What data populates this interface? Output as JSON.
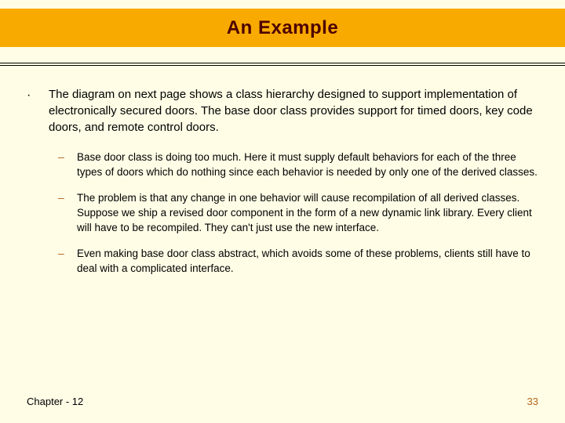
{
  "title": "An Example",
  "main_bullet": "The diagram on next page shows a class hierarchy designed to support implementation of electronically secured doors.  The base door class provides support for timed doors, key code doors, and remote control doors.",
  "sub_bullets": [
    "Base door class is doing too much.  Here it must supply default behaviors for each of the three types of doors which do nothing since each behavior is needed by only one of the derived classes.",
    "The problem is that any change in one behavior will cause recompilation of all derived classes.  Suppose we ship a revised door component in the form of a new dynamic link library.  Every client will have to be recompiled.  They can't just use the new interface.",
    "Even making base door class abstract, which avoids some of these problems, clients still have to deal with a complicated interface."
  ],
  "footer": {
    "chapter": "Chapter - 12",
    "page": "33"
  },
  "glyphs": {
    "main_dot": "·",
    "sub_dash": "–"
  }
}
